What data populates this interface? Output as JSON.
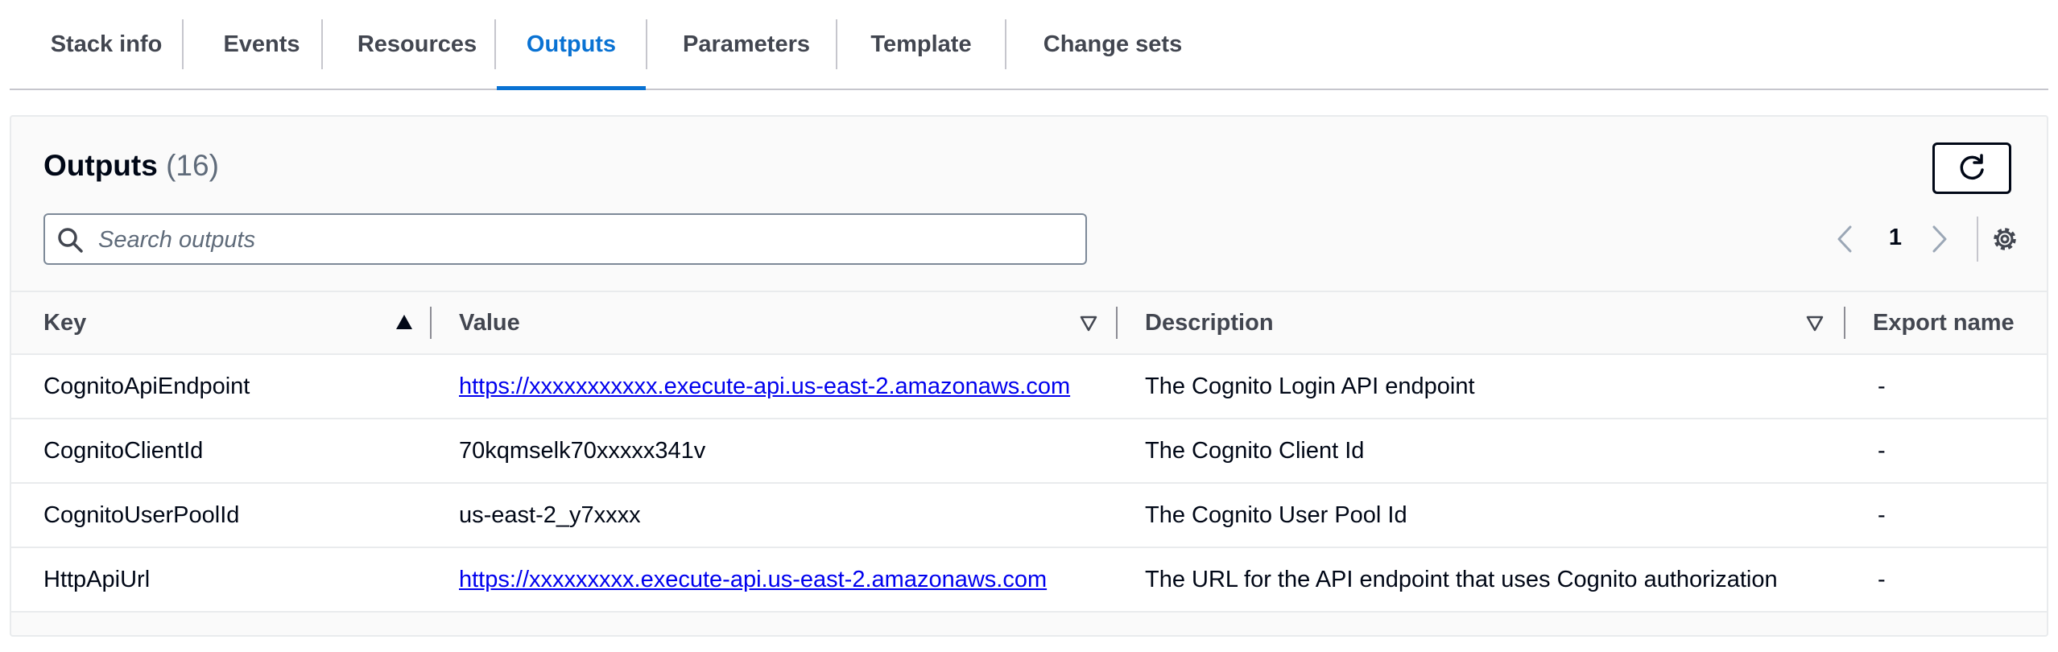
{
  "tabs": [
    {
      "label": "Stack info"
    },
    {
      "label": "Events"
    },
    {
      "label": "Resources"
    },
    {
      "label": "Outputs",
      "active": true
    },
    {
      "label": "Parameters"
    },
    {
      "label": "Template"
    },
    {
      "label": "Change sets"
    }
  ],
  "outputs": {
    "title": "Outputs",
    "count": "(16)",
    "search": {
      "placeholder": "Search outputs",
      "value": ""
    },
    "pagination": {
      "current_page": "1"
    },
    "columns": {
      "key": "Key",
      "value": "Value",
      "description": "Description",
      "export_name": "Export name"
    },
    "rows": [
      {
        "key": "CognitoApiEndpoint",
        "value": "https://xxxxxxxxxxx.execute-api.us-east-2.amazonaws.com",
        "value_is_link": true,
        "description": "The Cognito Login API endpoint",
        "export_name": "-"
      },
      {
        "key": "CognitoClientId",
        "value": "70kqmselk70xxxxx341v",
        "value_is_link": false,
        "description": "The Cognito Client Id",
        "export_name": "-"
      },
      {
        "key": "CognitoUserPoolId",
        "value": "us-east-2_y7xxxx",
        "value_is_link": false,
        "description": "The Cognito User Pool Id",
        "export_name": "-"
      },
      {
        "key": "HttpApiUrl",
        "value": "https://xxxxxxxxx.execute-api.us-east-2.amazonaws.com",
        "value_is_link": true,
        "description": "The URL for the API endpoint that uses Cognito authorization",
        "export_name": "-"
      }
    ]
  },
  "colors": {
    "accent": "#0972d3",
    "link": "#0000ee",
    "text": "#000716",
    "muted": "#5f6b7a"
  }
}
